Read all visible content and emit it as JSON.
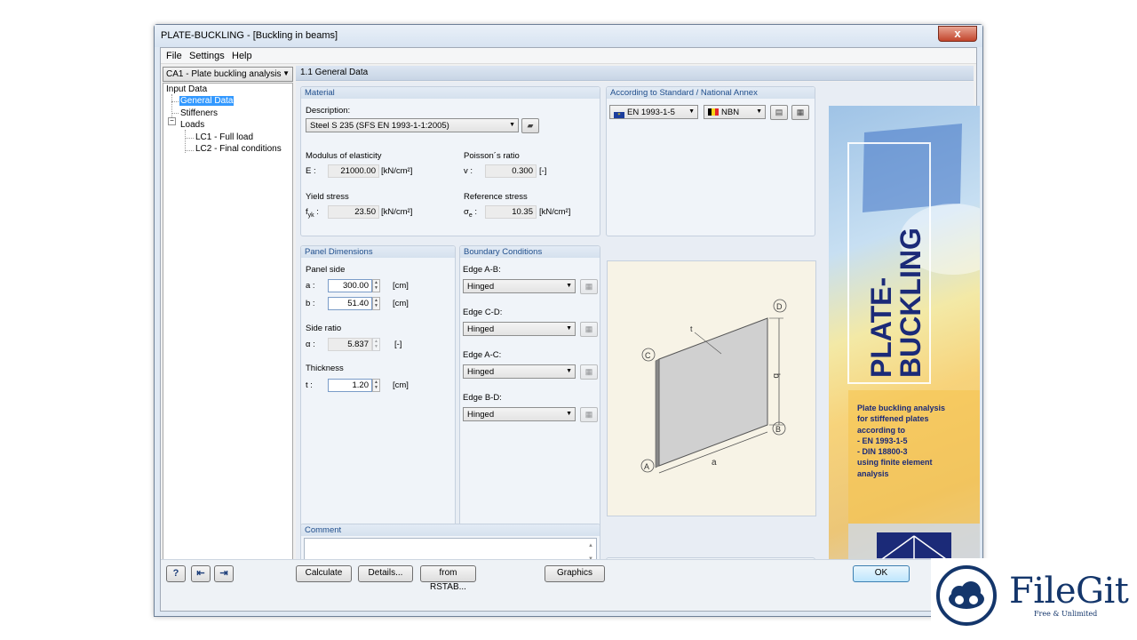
{
  "window": {
    "title": "PLATE-BUCKLING - [Buckling in beams]",
    "close": "x"
  },
  "menu": [
    "File",
    "Settings",
    "Help"
  ],
  "case_select": "CA1 - Plate buckling analysis",
  "nav": {
    "root": "Input Data",
    "general": "General Data",
    "stiffeners": "Stiffeners",
    "loads": "Loads",
    "lc1": "LC1 - Full load",
    "lc2": "LC2 - Final conditions"
  },
  "section_header": "1.1 General Data",
  "material": {
    "title": "Material",
    "description_label": "Description:",
    "description_value": "Steel S 235 (SFS EN 1993-1-1:2005)",
    "modulus_label": "Modulus of elasticity",
    "e_label": "E :",
    "e_value": "21000.00",
    "e_unit": "[kN/cm²]",
    "poisson_label": "Poisson´s ratio",
    "v_label": "v :",
    "v_value": "0.300",
    "v_unit": "[-]",
    "yield_label": "Yield stress",
    "fyk_label": "f",
    "fyk_sub": "yk",
    "fyk_colon": ":",
    "fyk_value": "23.50",
    "fyk_unit": "[kN/cm²]",
    "ref_label": "Reference stress",
    "sigma_label": "σ",
    "sigma_sub": "e",
    "sigma_colon": ":",
    "sigma_value": "10.35",
    "sigma_unit": "[kN/cm²]"
  },
  "standard": {
    "title": "According to Standard / National Annex",
    "standard_value": "EN 1993-1-5",
    "annex_value": "NBN"
  },
  "panel": {
    "title": "Panel Dimensions",
    "side_label": "Panel side",
    "a_label": "a :",
    "a_value": "300.00",
    "a_unit": "[cm]",
    "b_label": "b :",
    "b_value": "51.40",
    "b_unit": "[cm]",
    "ratio_label": "Side ratio",
    "alpha_label": "α :",
    "alpha_value": "5.837",
    "alpha_unit": "[-]",
    "thickness_label": "Thickness",
    "t_label": "t :",
    "t_value": "1.20",
    "t_unit": "[cm]"
  },
  "boundary": {
    "title": "Boundary Conditions",
    "edges": [
      {
        "label": "Edge A-B:",
        "value": "Hinged"
      },
      {
        "label": "Edge C-D:",
        "value": "Hinged"
      },
      {
        "label": "Edge A-C:",
        "value": "Hinged"
      },
      {
        "label": "Edge B-D:",
        "value": "Hinged"
      }
    ]
  },
  "graphic": {
    "A": "A",
    "B": "B",
    "C": "C",
    "D": "D",
    "a": "a",
    "b": "b",
    "t": "t"
  },
  "comment": {
    "title": "Comment",
    "value": ""
  },
  "banner": {
    "logo_line1": "PLATE-",
    "logo_line2": "BUCKLING",
    "desc": [
      "Plate buckling analysis",
      "for stiffened plates",
      "according to",
      "- EN 1993-1-5",
      "- DIN 18800-3",
      "using finite element",
      "analysis"
    ]
  },
  "buttons": {
    "calculate": "Calculate",
    "details": "Details...",
    "from_rstab": "from RSTAB...",
    "graphics": "Graphics",
    "ok": "OK",
    "help": "?"
  },
  "watermark": {
    "name": "FileGit",
    "tagline": "Free & Unlimited"
  },
  "colors": {
    "accent": "#1f4e8c",
    "selection": "#3399ff",
    "banner_text": "#1b2a78"
  }
}
